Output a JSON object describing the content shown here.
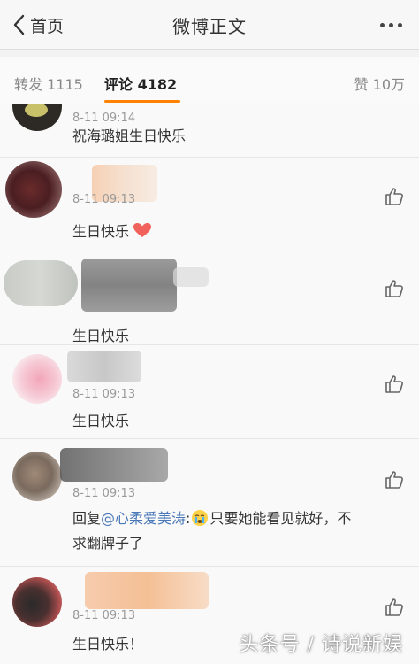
{
  "navbar": {
    "back_label": "首页",
    "title": "微博正文"
  },
  "tabs": [
    {
      "label": "转发 1115"
    },
    {
      "label": "评论 4182"
    },
    {
      "label": "赞 10万"
    }
  ],
  "comments": [
    {
      "time": "8-11 09:14",
      "text": "祝海璐姐生日快乐"
    },
    {
      "time": "8-11 09:13",
      "text": "生日快乐"
    },
    {
      "text": "生日快乐"
    },
    {
      "time": "8-11 09:13",
      "text": "生日快乐"
    },
    {
      "time": "8-11 09:13",
      "reply_prefix": "回复",
      "mention": "@心柔爱美涛",
      "reply_line1": ":",
      "reply_line1b": "只要她能看见就好，不",
      "reply_line2": "求翻牌子了"
    },
    {
      "time": "8-11 09:13",
      "text": "生日快乐！"
    }
  ],
  "watermark": "头条号 / 诗说新娱",
  "colors": {
    "accent": "#ff8200",
    "mention": "#4a78b8"
  }
}
